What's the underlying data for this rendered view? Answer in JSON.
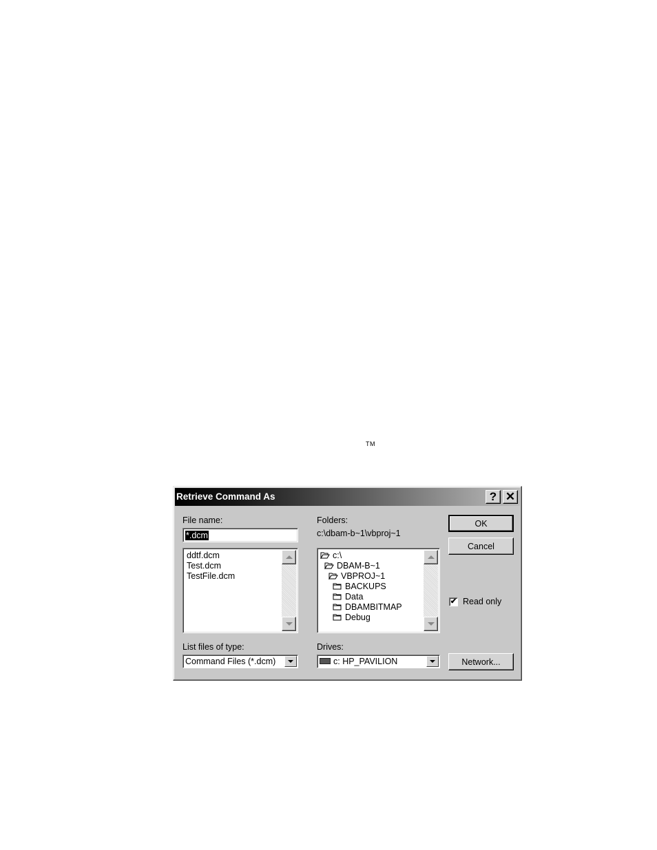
{
  "trademark": "TM",
  "dialog": {
    "title": "Retrieve Command As",
    "help_label": "?",
    "close_label": "✕",
    "file_name_label": "File name:",
    "file_name_value": "*.dcm",
    "files": [
      "ddtf.dcm",
      "Test.dcm",
      "TestFile.dcm"
    ],
    "folders_label": "Folders:",
    "current_path": "c:\\dbam-b~1\\vbproj~1",
    "folders": [
      {
        "name": "c:\\",
        "icon": "open-folder-icon",
        "indent": 0
      },
      {
        "name": "DBAM-B~1",
        "icon": "open-folder-icon",
        "indent": 1
      },
      {
        "name": "VBPROJ~1",
        "icon": "open-folder-icon",
        "indent": 2
      },
      {
        "name": "BACKUPS",
        "icon": "folder-icon",
        "indent": 3
      },
      {
        "name": "Data",
        "icon": "folder-icon",
        "indent": 3
      },
      {
        "name": "DBAMBITMAP",
        "icon": "folder-icon",
        "indent": 3
      },
      {
        "name": "Debug",
        "icon": "folder-icon",
        "indent": 3
      }
    ],
    "list_type_label": "List files of type:",
    "list_type_value": "Command Files (*.dcm)",
    "drives_label": "Drives:",
    "drives_value": "c: HP_PAVILION",
    "ok_label": "OK",
    "cancel_label": "Cancel",
    "read_only_label": "Read only",
    "read_only_checked": true,
    "network_label": "Network..."
  }
}
